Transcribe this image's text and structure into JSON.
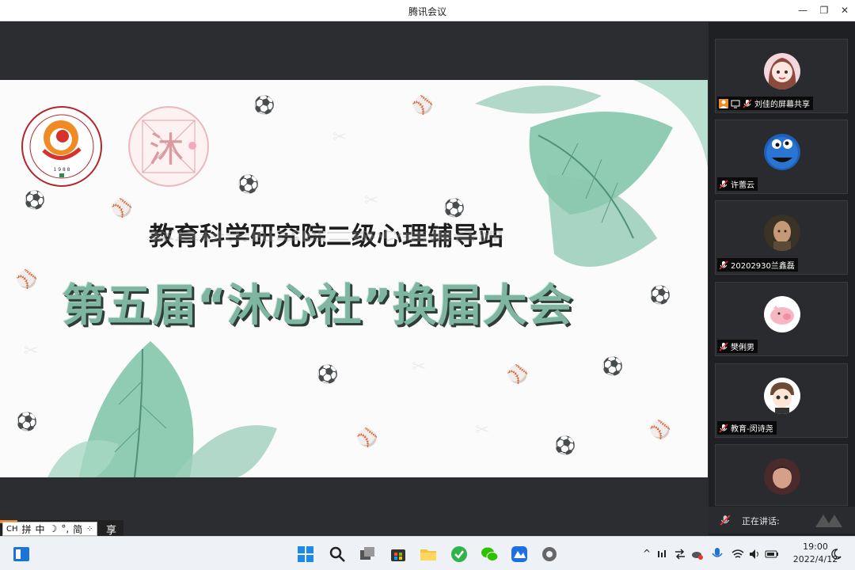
{
  "window": {
    "title": "腾讯会议",
    "controls": {
      "minimize": "—",
      "restore": "❐",
      "close": "✕"
    }
  },
  "slide": {
    "subtitle": "教育科学研究院二级心理辅导站",
    "main_title": "第五届“沐心社”换届大会",
    "logo2_char": "沐"
  },
  "share_indicator": {
    "text": "享"
  },
  "ime": {
    "items": [
      "CH",
      "拼",
      "中",
      "☽",
      "°,",
      "简",
      "⁘"
    ]
  },
  "participants": [
    {
      "name": "刘佳的屏幕共享",
      "avatar": "cartoon-girl-avatar",
      "sharing": true
    },
    {
      "name": "许蕾云",
      "avatar": "cookie-monster-avatar",
      "sharing": false
    },
    {
      "name": "20202930兰鑫磊",
      "avatar": "person-photo-avatar",
      "sharing": false
    },
    {
      "name": "樊俐男",
      "avatar": "pink-pig-avatar",
      "sharing": false
    },
    {
      "name": "教育-闵诗尧",
      "avatar": "cartoon-boy-avatar",
      "sharing": false
    },
    {
      "name": "",
      "avatar": "woman-photo-avatar",
      "sharing": false
    }
  ],
  "speaking": {
    "label": "正在讲话:"
  },
  "taskbar": {
    "apps": [
      "start-icon",
      "search-icon",
      "task-view-icon",
      "store-icon",
      "file-explorer-icon",
      "browser-icon",
      "wechat-icon",
      "tencent-meeting-icon",
      "settings-icon"
    ],
    "clock": {
      "time": "19:00",
      "date": "2022/4/12"
    }
  },
  "colors": {
    "accent_green": "#7fb6a1",
    "share_orange": "#f08a24",
    "panel_bg": "#1f2023"
  }
}
